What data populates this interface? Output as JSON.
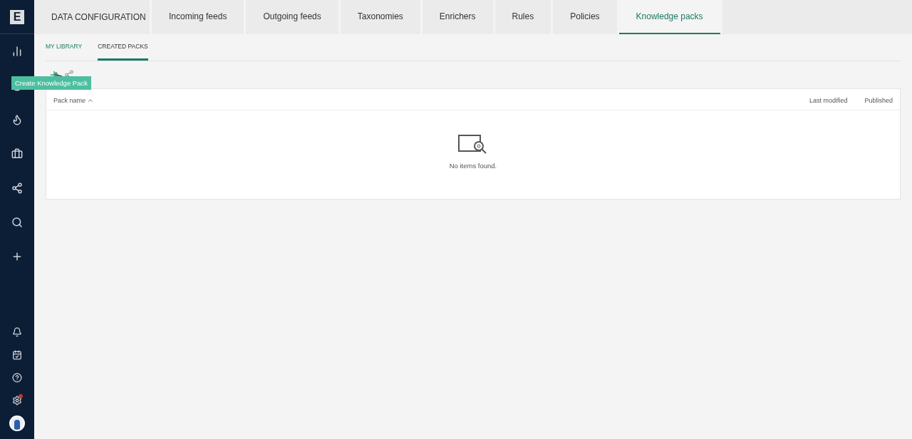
{
  "sidebar": {
    "logo": "E",
    "items": [
      {
        "kind": "chart"
      },
      {
        "kind": "target"
      },
      {
        "kind": "fire"
      },
      {
        "kind": "briefcase"
      },
      {
        "kind": "graph"
      },
      {
        "kind": "search"
      },
      {
        "kind": "plus"
      }
    ],
    "bottom": [
      {
        "kind": "bell",
        "alert": false
      },
      {
        "kind": "calendar",
        "alert": false
      },
      {
        "kind": "help",
        "alert": false
      },
      {
        "kind": "settings",
        "alert": true
      },
      {
        "kind": "avatar",
        "alert": false
      }
    ]
  },
  "section_title": "DATA CONFIGURATION",
  "tabs": [
    {
      "label": "Incoming feeds",
      "selected": false
    },
    {
      "label": "Outgoing feeds",
      "selected": false
    },
    {
      "label": "Taxonomies",
      "selected": false
    },
    {
      "label": "Enrichers",
      "selected": false
    },
    {
      "label": "Rules",
      "selected": false
    },
    {
      "label": "Policies",
      "selected": false
    },
    {
      "label": "Knowledge packs",
      "selected": true
    }
  ],
  "subtabs": [
    {
      "label": "MY LIBRARY",
      "selected": false
    },
    {
      "label": "CREATED PACKS",
      "selected": true
    }
  ],
  "tooltip": "Create Knowledge Pack",
  "table": {
    "columns": [
      {
        "label": "Pack name",
        "sorted": true
      },
      {
        "label": "Last modified",
        "sorted": false
      },
      {
        "label": "Published",
        "sorted": false
      }
    ],
    "empty_message": "No items found."
  }
}
